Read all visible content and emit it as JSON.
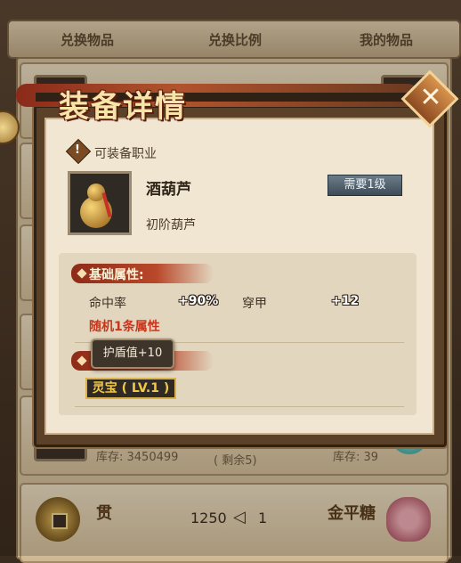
{
  "tabs": [
    "兑换物品",
    "兑换比例",
    "我的物品"
  ],
  "bg_rows": {
    "stock_left": "库存: 3450499",
    "remaining": "( 剩余5)",
    "stock_right": "库存: 39",
    "currency_name": "贯",
    "exchange_amount": "1250",
    "arrow": "◁",
    "exchange_count": "1",
    "target_item": "金平糖"
  },
  "modal": {
    "title": "装备详情",
    "close_icon": "close-icon",
    "job_label": "可装备职业",
    "item_name": "酒葫芦",
    "level_required": "需要1级",
    "item_desc": "初阶葫芦",
    "base_attr_title": "基础属性:",
    "attributes": [
      {
        "label": "命中率",
        "value": "+90%"
      },
      {
        "label": "穿甲",
        "value": "+12"
      }
    ],
    "random_attr": "随机1条属性",
    "tooltip": "护盾值+10",
    "lingbao": "灵宝 ( LV.1 )"
  },
  "colors": {
    "title_gold": "#f6e4a8",
    "random_red": "#c8361c",
    "lingbao_gold": "#f2c844"
  }
}
